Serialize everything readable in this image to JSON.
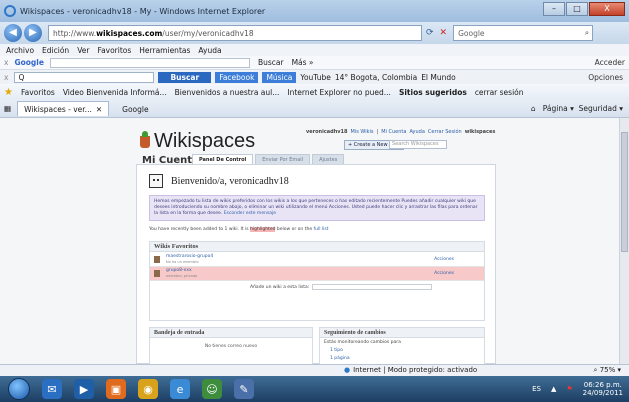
{
  "window": {
    "title": "Wikispaces - veronicadhv18 - My - Windows Internet Explorer",
    "controls": {
      "minimize": "–",
      "maximize": "□",
      "close": "X"
    }
  },
  "address": {
    "prefix": "http://www.",
    "host": "wikispaces.com",
    "path": "/user/my/veronicadhv18",
    "search_placeholder": "Google"
  },
  "menu": [
    "Archivo",
    "Edición",
    "Ver",
    "Favoritos",
    "Herramientas",
    "Ayuda"
  ],
  "google_toolbar": {
    "logo": "Google",
    "buscar": "Buscar",
    "mas": "Más »",
    "acceder": "Acceder"
  },
  "second_toolbar": {
    "query": "Q",
    "buscar_button": "Buscar",
    "facebook": "Facebook",
    "musica": "Música",
    "youtube": "YouTube",
    "weather": "14° Bogota, Colombia",
    "el_mundo": "El Mundo",
    "opciones": "Opciones"
  },
  "favorites": {
    "label": "Favoritos",
    "items": [
      "Video Bienvenida Informá...",
      "Bienvenidos a nuestra aul...",
      "Internet Explorer no pued...",
      "Sitios sugeridos",
      "cerrar sesión"
    ]
  },
  "tabs": [
    {
      "label": "Wikispaces - ver..."
    },
    {
      "label": "Google"
    }
  ],
  "tab_tools": {
    "pagina": "Página",
    "seguridad": "Seguridad"
  },
  "wikispaces": {
    "logo": "Wikispaces",
    "topnav": {
      "user": "veronicadhv18",
      "my_wikis": "Mis Wikis",
      "account": "Mi Cuenta",
      "help": "Ayuda",
      "logout": "Cerrar Sesión",
      "brand": "wikispaces"
    },
    "new_wiki": "+ Create a New Wiki",
    "search_placeholder": "Search Wikispaces",
    "section_title": "Mi Cuenta",
    "page_tabs": [
      "Panel De Control",
      "Enviar Por Email",
      "Ajustes"
    ],
    "welcome": "Bienvenido/a, veronicadhv18",
    "notice": "Hemos empezado tu lista de wikis preferidos con los wikis a los que perteneces o has editado recientemente Puedes añadir cualquier wiki que desees introduciendo su nombre abajo, o eliminar un wiki utilizando el menú Acciones. Usted puede hacer clic y arrastrar las filas para ordenar la lista en la forma que desee.",
    "notice_link": "Esconder este mensaje",
    "added_note_pre": "You have recently been added to 1 wiki. It is",
    "added_note_hl": "highlighted",
    "added_note_post": "below or on the",
    "added_note_link": "full list",
    "fav_header": "Wikis Favoritos",
    "wikis": [
      {
        "name": "maestrarosio-grupo4",
        "sub": "No ha un miembro",
        "action": "Acciones"
      },
      {
        "name": "grupo8-xxx",
        "sub": "miembro, privado",
        "action": "Acciones"
      }
    ],
    "add_wiki_label": "Añade un wiki a esta lista:",
    "inbox_header": "Bandeja de entrada",
    "inbox_empty": "No tienes correo nuevo",
    "tracking_header": "Seguimiento de cambios",
    "tracking_line": "Estás monitoreando cambios para",
    "tracking_links": [
      "1 tipo",
      "1 página"
    ]
  },
  "status": {
    "mode": "Internet | Modo protegido: activado",
    "zoom": "75%"
  },
  "taskbar": {
    "language": "ES",
    "time": "06:26 p.m.",
    "date": "24/09/2011"
  }
}
